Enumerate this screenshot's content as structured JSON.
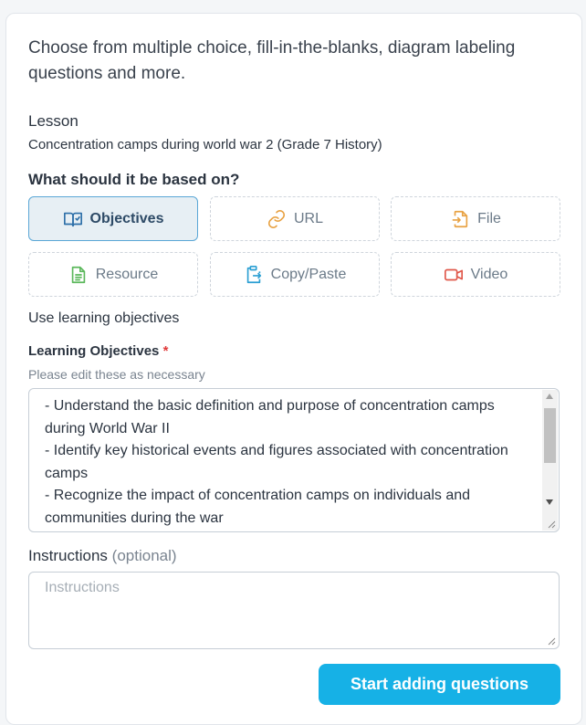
{
  "intro": "Choose from multiple choice, fill-in-the-blanks, diagram labeling questions and more.",
  "lesson": {
    "heading": "Lesson",
    "value": "Concentration camps during world war 2 (Grade 7 History)"
  },
  "based_on": {
    "heading": "What should it be based on?",
    "options": [
      {
        "label": "Objectives",
        "icon": "open-book-icon",
        "color": "#2d6fa8",
        "selected": true
      },
      {
        "label": "URL",
        "icon": "link-icon",
        "color": "#e8a243",
        "selected": false
      },
      {
        "label": "File",
        "icon": "file-import-icon",
        "color": "#e8a243",
        "selected": false
      },
      {
        "label": "Resource",
        "icon": "document-icon",
        "color": "#5cb85c",
        "selected": false
      },
      {
        "label": "Copy/Paste",
        "icon": "clipboard-icon",
        "color": "#2b9fd3",
        "selected": false
      },
      {
        "label": "Video",
        "icon": "video-icon",
        "color": "#e0574a",
        "selected": false
      }
    ]
  },
  "use_text": "Use learning objectives",
  "learning_objectives": {
    "heading": "Learning Objectives",
    "required_mark": "*",
    "subtext": "Please edit these as necessary",
    "value": "- Understand the basic definition and purpose of concentration camps during World War II\n- Identify key historical events and figures associated with concentration camps\n- Recognize the impact of concentration camps on individuals and communities during the war"
  },
  "instructions": {
    "heading": "Instructions",
    "optional": "(optional)",
    "placeholder": "Instructions"
  },
  "start_button": "Start adding questions",
  "colors": {
    "accent": "#16b1e6",
    "selected_border": "#5aa7d6",
    "required": "#e03a3a"
  }
}
